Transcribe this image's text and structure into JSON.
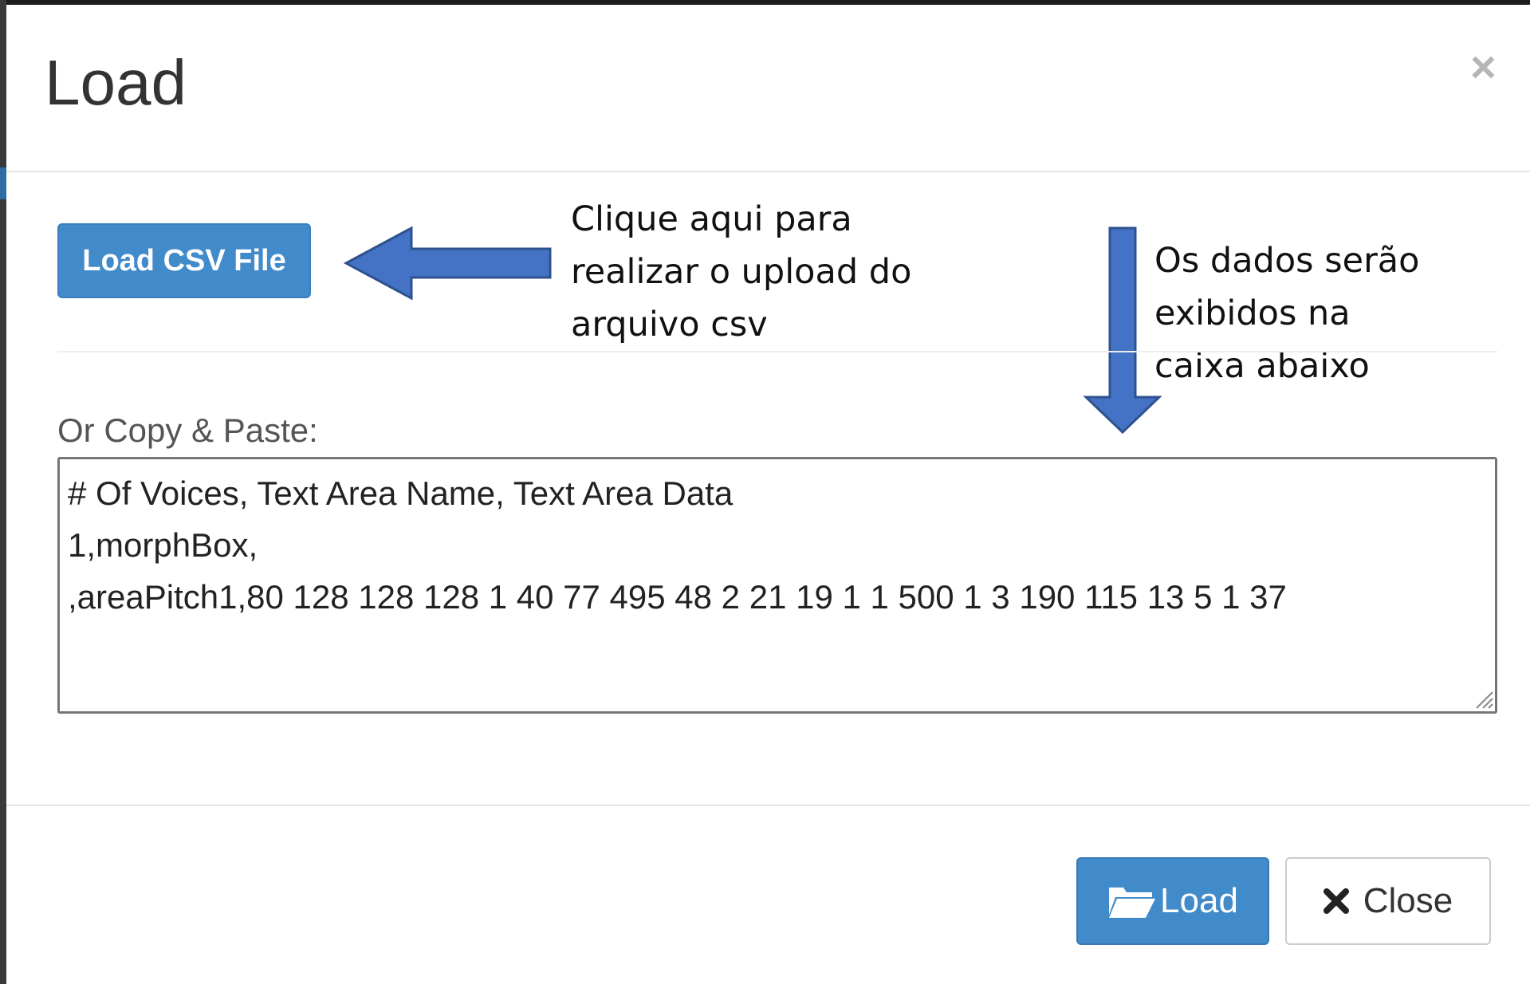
{
  "modal": {
    "title": "Load",
    "close_symbol": "×"
  },
  "upload": {
    "button_label": "Load CSV File"
  },
  "annotations": {
    "left_lines": [
      "Clique aqui para",
      "realizar o upload do",
      "arquivo csv"
    ],
    "right_lines": [
      "Os dados serão",
      "exibidos na",
      "caixa abaixo"
    ],
    "arrow_color": "#4472c4"
  },
  "paste": {
    "label": "Or Copy & Paste:",
    "content": "# Of Voices, Text Area Name, Text Area Data\n1,morphBox,\n,areaPitch1,80 128 128 128 1 40 77 495 48 2 21 19 1 1 500 1 3 190 115 13 5 1 37"
  },
  "footer": {
    "load_label": "Load",
    "load_icon": "folder-open-icon",
    "close_label": "Close",
    "close_icon": "times-icon"
  },
  "colors": {
    "primary": "#428bca",
    "annotation_arrow": "#4472c4"
  }
}
